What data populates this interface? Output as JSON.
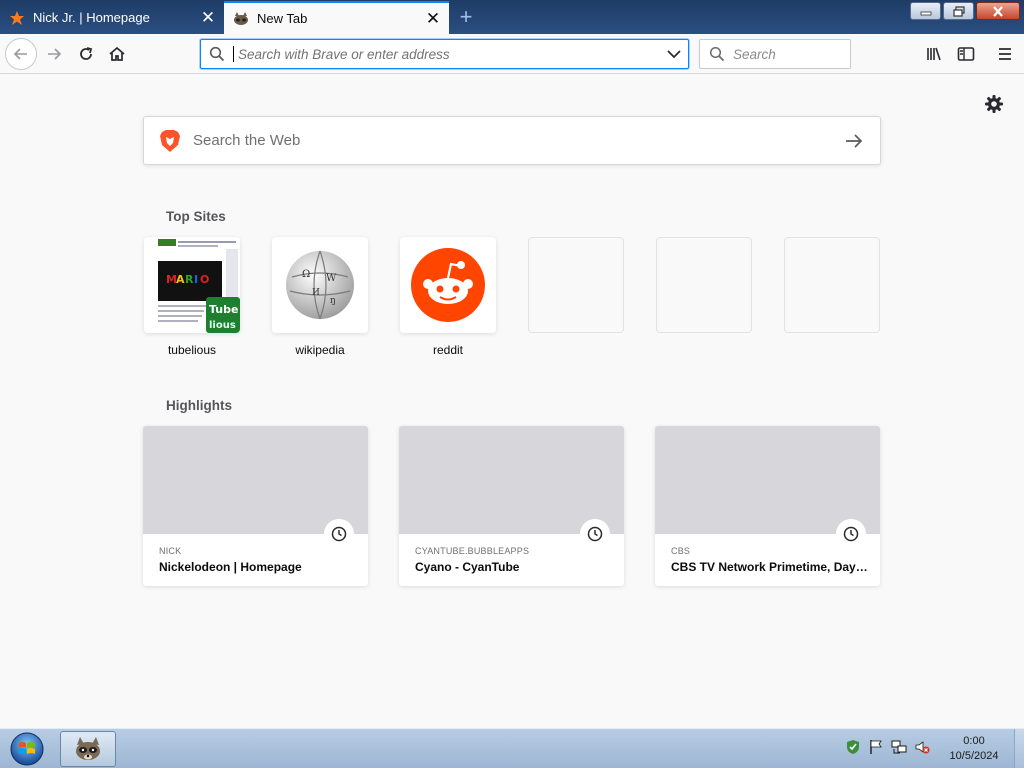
{
  "tabs": [
    {
      "title": "Nick Jr. | Homepage",
      "active": false
    },
    {
      "title": "New Tab",
      "active": true
    }
  ],
  "nav": {
    "url_placeholder": "Search with Brave or enter address",
    "search_placeholder": "Search"
  },
  "content": {
    "web_search_placeholder": "Search the Web",
    "top_sites_title": "Top Sites",
    "top_sites": [
      {
        "label": "tubelious"
      },
      {
        "label": "wikipedia"
      },
      {
        "label": "reddit"
      }
    ],
    "highlights_title": "Highlights",
    "highlights": [
      {
        "domain": "NICK",
        "title": "Nickelodeon | Homepage"
      },
      {
        "domain": "CYANTUBE.BUBBLEAPPS",
        "title": "Cyano - CyanTube"
      },
      {
        "domain": "CBS",
        "title": "CBS TV Network Primetime, Daytime, Late Night..."
      }
    ]
  },
  "taskbar": {
    "time": "0:00",
    "date": "10/5/2024"
  },
  "colors": {
    "accent": "#0a84ff",
    "reddit": "#ff4500",
    "tabstrip": "#1f3c66"
  }
}
